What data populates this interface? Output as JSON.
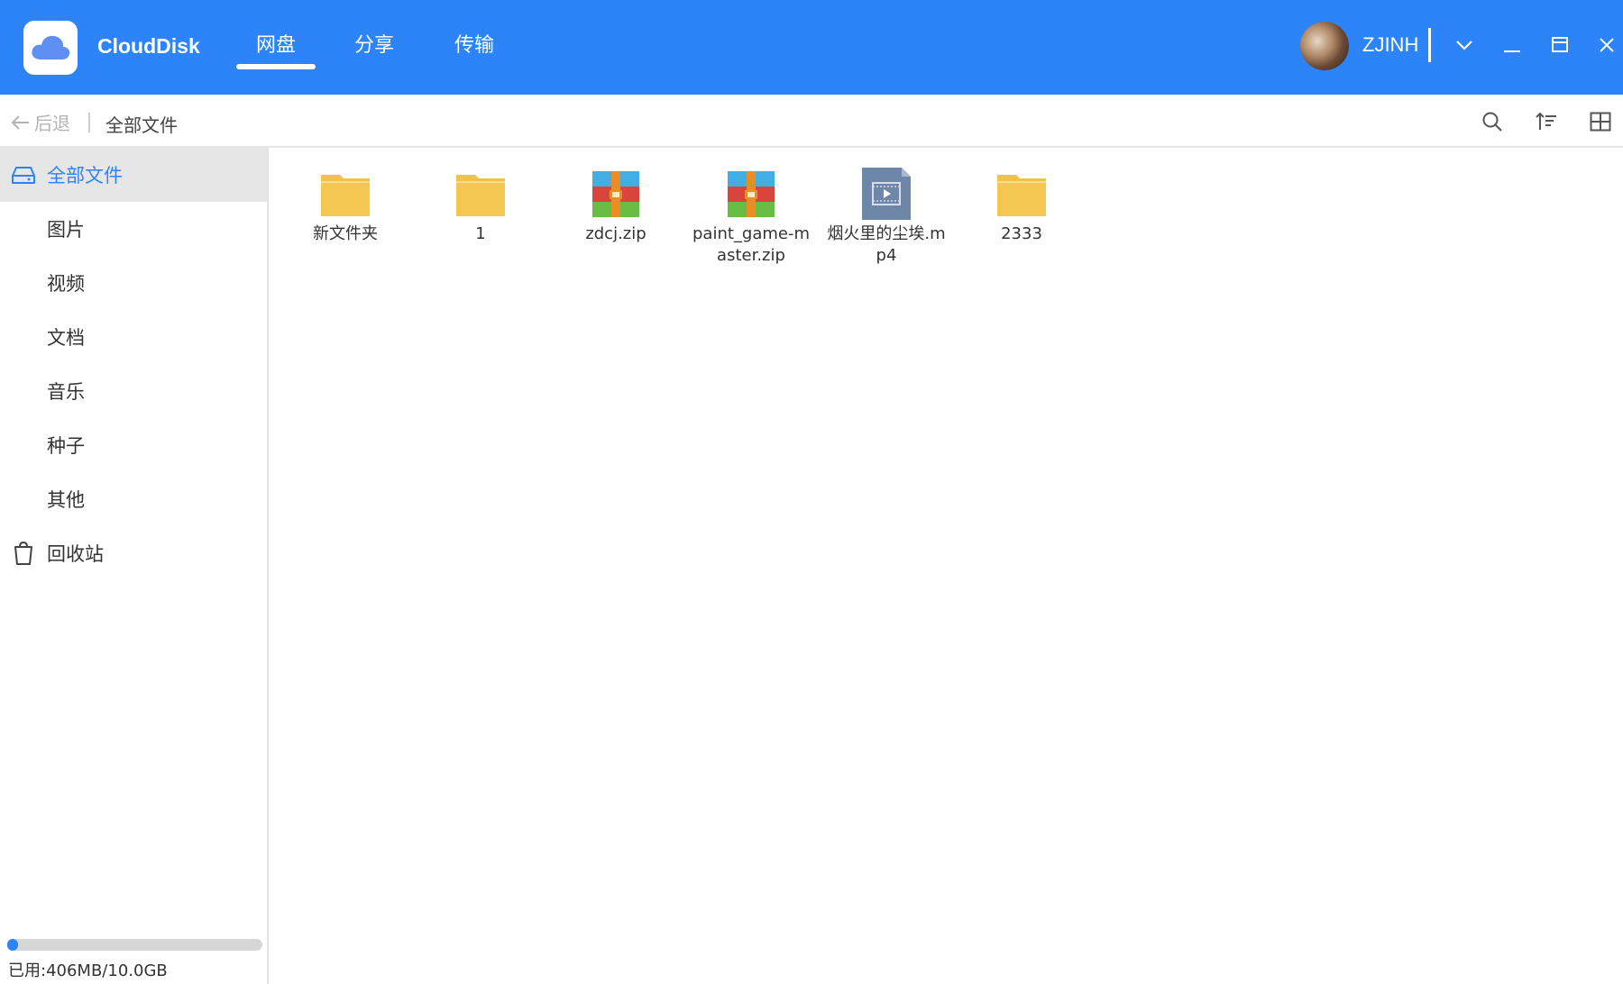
{
  "window": {
    "app_name": "CloudDisk",
    "accent_color": "#2c84f8",
    "user": {
      "name": "ZJINH",
      "avatar": "user-avatar"
    },
    "controls": [
      "chevron-down-icon",
      "minimize-icon",
      "maximize-icon",
      "close-icon"
    ]
  },
  "nav": {
    "tabs": [
      {
        "label": "网盘",
        "active": true
      },
      {
        "label": "分享",
        "active": false
      },
      {
        "label": "传输",
        "active": false
      }
    ]
  },
  "toolbar": {
    "back_label": "后退",
    "breadcrumb": "全部文件",
    "icons": [
      "search-icon",
      "sort-icon",
      "grid-view-icon"
    ]
  },
  "sidebar": {
    "items": [
      {
        "label": "全部文件",
        "icon": "hard-drive-icon",
        "active": true
      },
      {
        "label": "图片",
        "icon": "",
        "active": false
      },
      {
        "label": "视频",
        "icon": "",
        "active": false
      },
      {
        "label": "文档",
        "icon": "",
        "active": false
      },
      {
        "label": "音乐",
        "icon": "",
        "active": false
      },
      {
        "label": "种子",
        "icon": "",
        "active": false
      },
      {
        "label": "其他",
        "icon": "",
        "active": false
      },
      {
        "label": "回收站",
        "icon": "trash-icon",
        "active": false
      }
    ],
    "storage": {
      "used_fraction": 0.04,
      "text": "已用:406MB/10.0GB"
    }
  },
  "files": [
    {
      "name": "新文件夹",
      "type": "folder"
    },
    {
      "name": "1",
      "type": "folder"
    },
    {
      "name": "zdcj.zip",
      "type": "zip"
    },
    {
      "name": "paint_game-master.zip",
      "type": "zip"
    },
    {
      "name": "烟火里的尘埃.mp4",
      "type": "video"
    },
    {
      "name": "2333",
      "type": "folder"
    }
  ]
}
